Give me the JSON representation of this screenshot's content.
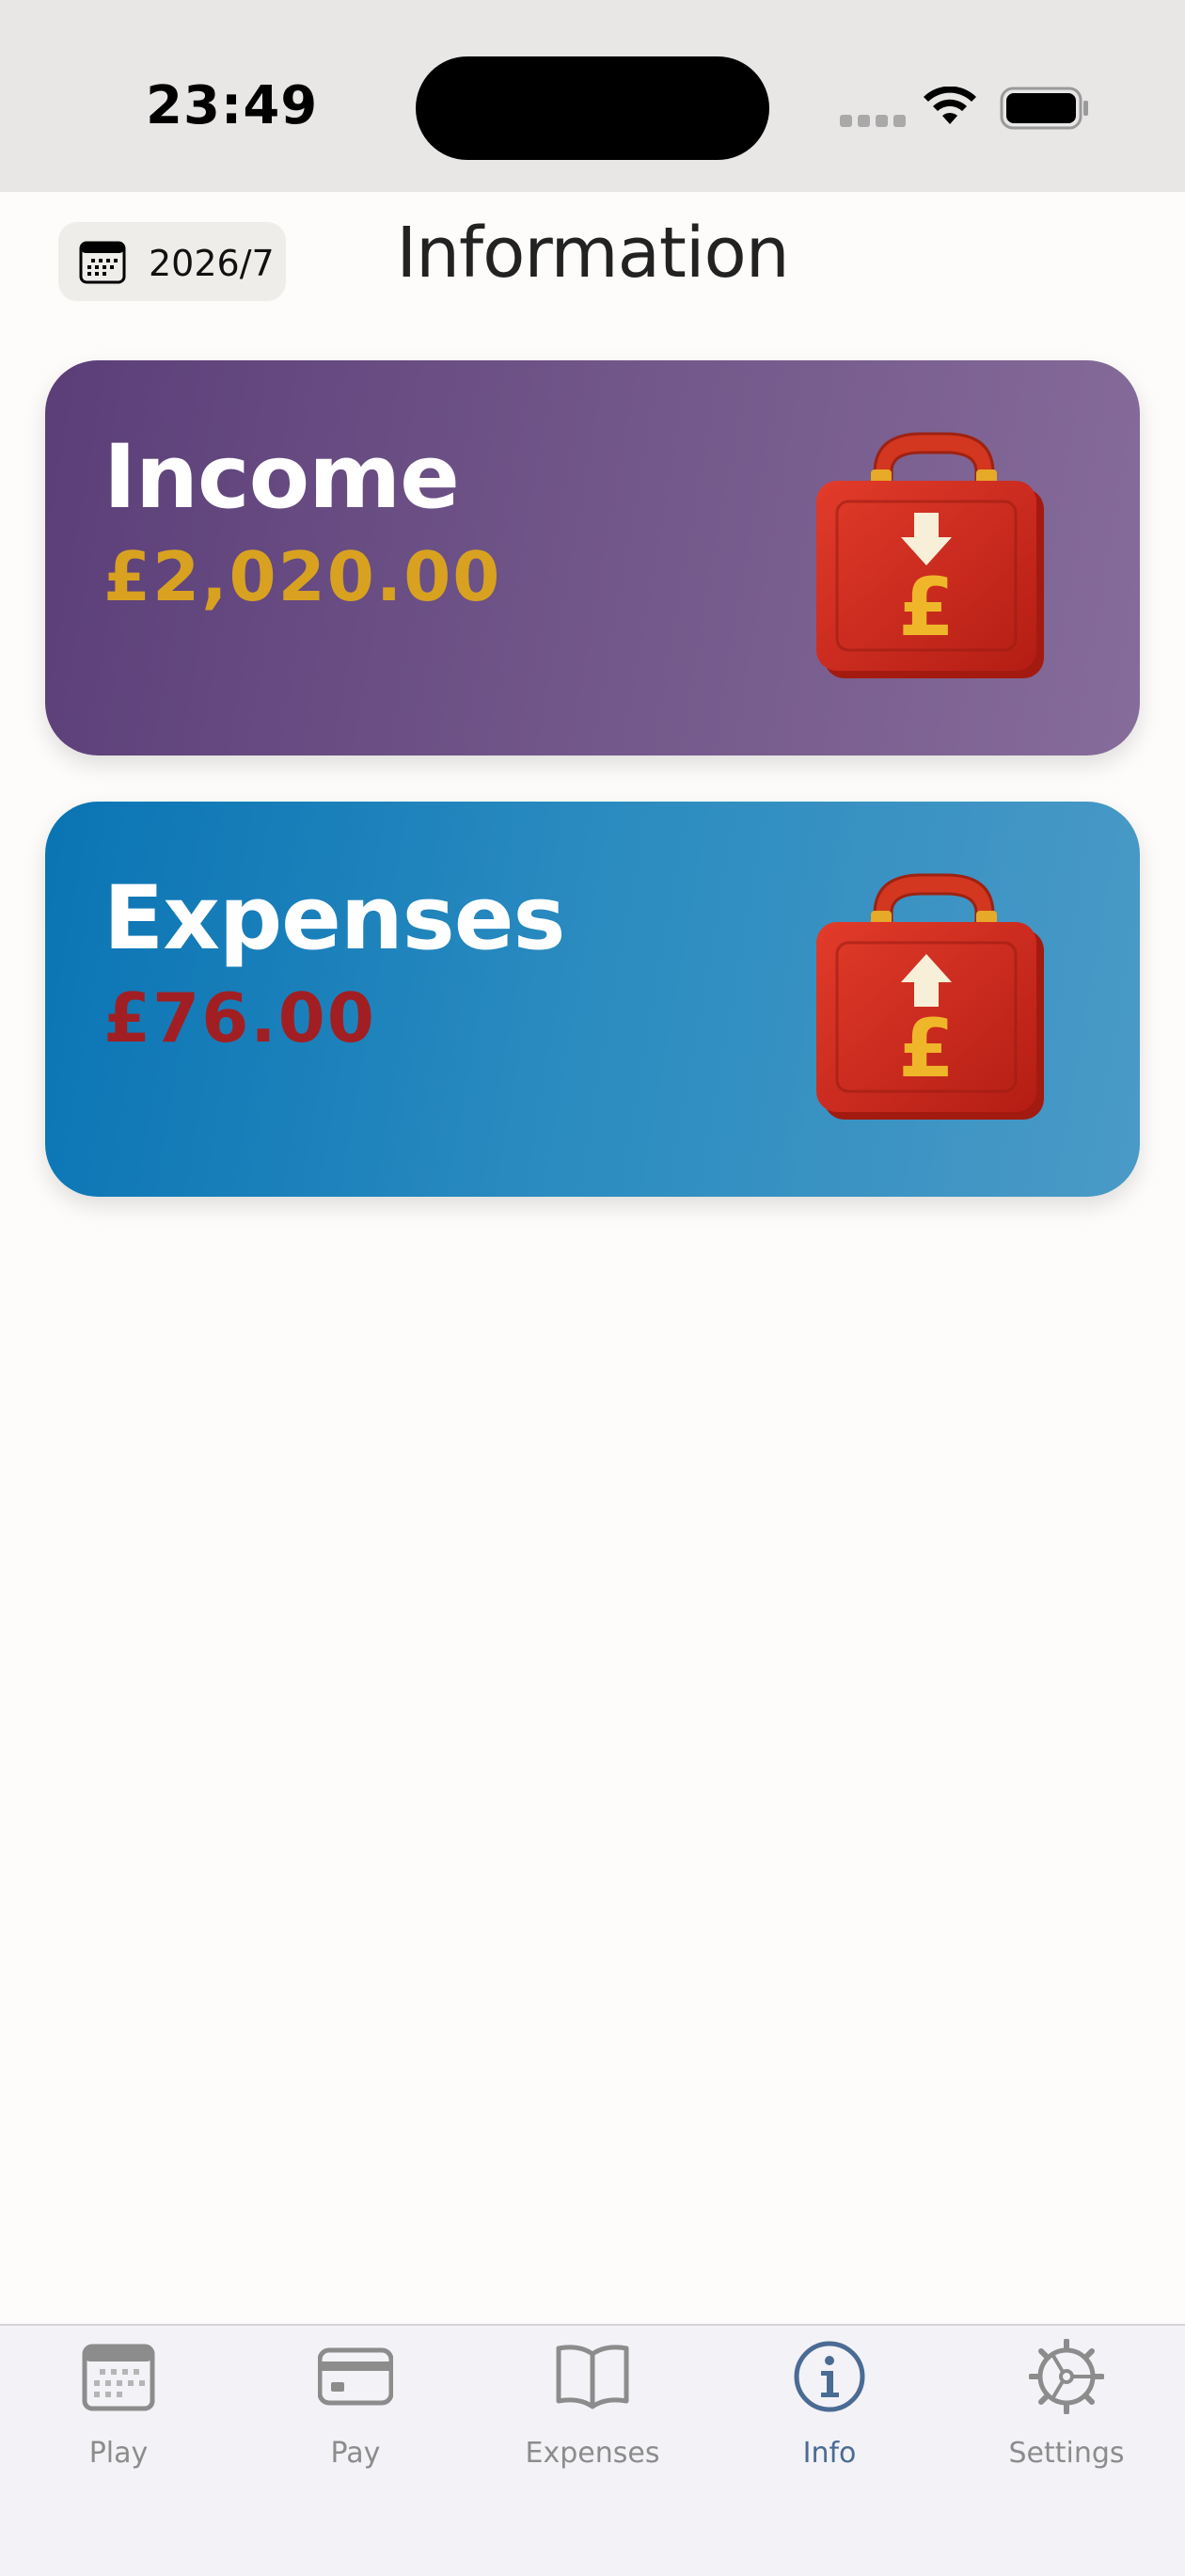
{
  "status_bar": {
    "time": "23:49"
  },
  "header": {
    "date": "2026/7",
    "title": "Information"
  },
  "cards": {
    "income": {
      "title": "Income",
      "amount": "£2,020.00"
    },
    "expenses": {
      "title": "Expenses",
      "amount": "£76.00"
    }
  },
  "tab_bar": {
    "items": [
      {
        "label": "Play",
        "icon": "calendar-icon"
      },
      {
        "label": "Pay",
        "icon": "credit-card-icon"
      },
      {
        "label": "Expenses",
        "icon": "book-icon"
      },
      {
        "label": "Info",
        "icon": "info-icon",
        "active": true
      },
      {
        "label": "Settings",
        "icon": "gear-icon"
      }
    ]
  },
  "colors": {
    "income_amount": "#d8a220",
    "expense_amount": "#a11f22",
    "active_tab": "#4a6b94"
  }
}
